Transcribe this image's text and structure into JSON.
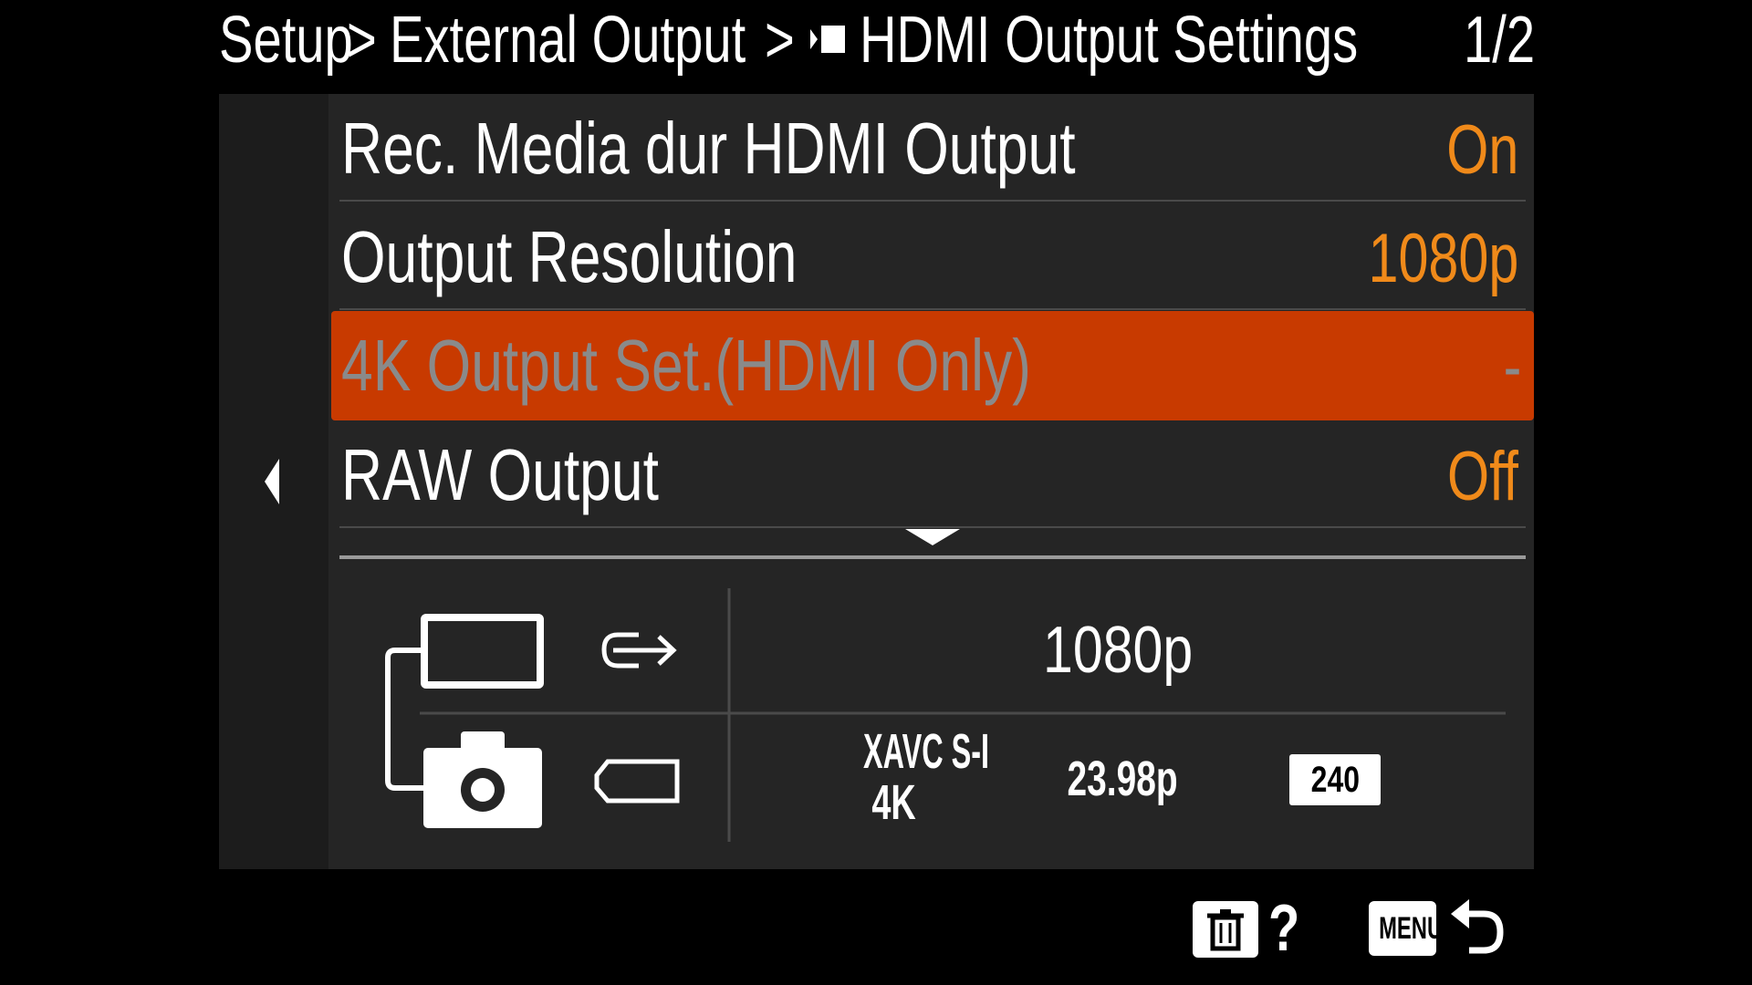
{
  "header": {
    "crumb_1": "Setup",
    "sep_1": ">",
    "crumb_2": "External Output",
    "sep_2": ">",
    "title": "HDMI Output Settings",
    "page": "1/2",
    "title_icon": "video-mode-icon"
  },
  "menu": {
    "items": [
      {
        "label": "Rec. Media dur HDMI Output",
        "value": "On"
      },
      {
        "label": "Output Resolution",
        "value": "1080p"
      },
      {
        "label": "4K Output Set.(HDMI Only)",
        "value": "-",
        "selected": true
      },
      {
        "label": "RAW Output",
        "value": "Off"
      }
    ]
  },
  "info": {
    "output_resolution": "1080p",
    "codec_line1": "XAVC S-I",
    "codec_line2": "4K",
    "frame_rate": "23.98p",
    "bitrate": "240",
    "icons": [
      "external-monitor-icon",
      "camera-icon",
      "hdmi-output-icon",
      "memory-card-icon",
      "film-bitrate-icon"
    ]
  },
  "footer": {
    "help": "?",
    "menu": "MENU",
    "icons": [
      "trash-icon",
      "help-icon",
      "menu-button-icon",
      "back-arrow-icon"
    ]
  },
  "colors": {
    "background": "#000000",
    "panel": "#252525",
    "accent_orange": "#f08a1a",
    "selection": "#c83a00",
    "disabled_text": "#8a8a8a"
  }
}
